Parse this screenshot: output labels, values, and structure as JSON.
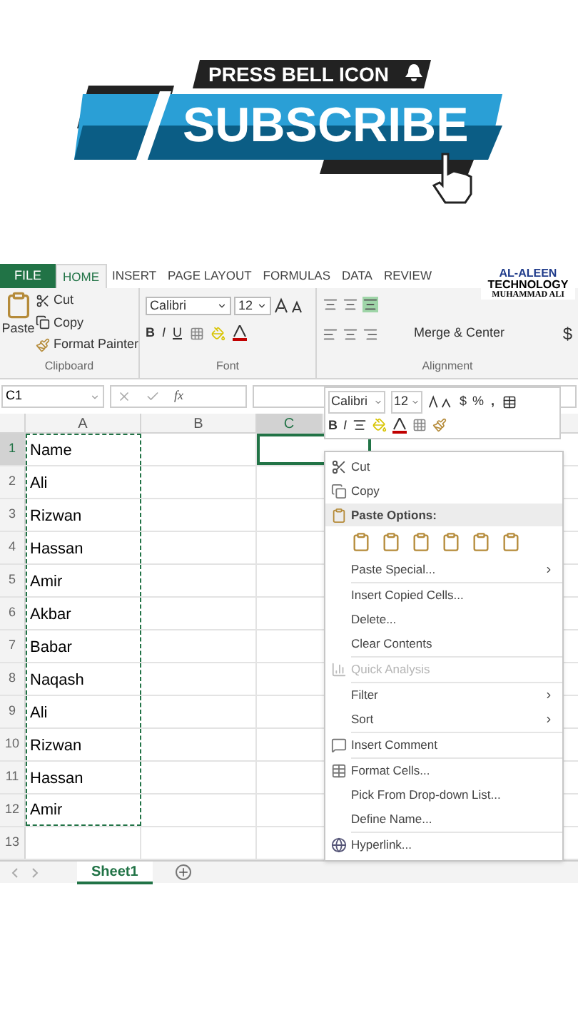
{
  "banner": {
    "top_text": "PRESS BELL ICON",
    "main_text": "SUBSCRIBE"
  },
  "logo": {
    "line1": "AL-ALEEN",
    "line2": "TECHNOLOGY",
    "line3": "MUHAMMAD ALI"
  },
  "tabs": [
    {
      "label": "FILE",
      "kind": "file",
      "selected": false
    },
    {
      "label": "HOME",
      "kind": "tab",
      "selected": true
    },
    {
      "label": "INSERT",
      "kind": "tab",
      "selected": false
    },
    {
      "label": "PAGE LAYOUT",
      "kind": "tab",
      "selected": false
    },
    {
      "label": "FORMULAS",
      "kind": "tab",
      "selected": false
    },
    {
      "label": "DATA",
      "kind": "tab",
      "selected": false
    },
    {
      "label": "REVIEW",
      "kind": "tab",
      "selected": false
    }
  ],
  "clipboard": {
    "paste": "Paste",
    "cut": "Cut",
    "copy": "Copy",
    "format_painter": "Format Painter",
    "group_label": "Clipboard"
  },
  "font": {
    "font_name": "Calibri",
    "font_size": "12",
    "bold": "B",
    "italic": "I",
    "underline": "U",
    "group_label": "Font"
  },
  "alignment": {
    "merge": "Merge & Center",
    "group_label": "Alignment",
    "currency": "$"
  },
  "formula_bar": {
    "name_box": "C1",
    "fx": "fx"
  },
  "columns": [
    {
      "label": "A",
      "selected": false
    },
    {
      "label": "B",
      "selected": false
    },
    {
      "label": "C",
      "selected": true
    }
  ],
  "rows": [
    {
      "number": "1",
      "value": "Name",
      "selected": true
    },
    {
      "number": "2",
      "value": "Ali",
      "selected": false
    },
    {
      "number": "3",
      "value": "Rizwan",
      "selected": false
    },
    {
      "number": "4",
      "value": "Hassan",
      "selected": false
    },
    {
      "number": "5",
      "value": "Amir",
      "selected": false
    },
    {
      "number": "6",
      "value": "Akbar",
      "selected": false
    },
    {
      "number": "7",
      "value": "Babar",
      "selected": false
    },
    {
      "number": "8",
      "value": "Naqash",
      "selected": false
    },
    {
      "number": "9",
      "value": "Ali",
      "selected": false
    },
    {
      "number": "10",
      "value": "Rizwan",
      "selected": false
    },
    {
      "number": "11",
      "value": "Hassan",
      "selected": false
    },
    {
      "number": "12",
      "value": "Amir",
      "selected": false
    },
    {
      "number": "13",
      "value": "",
      "selected": false
    }
  ],
  "mini_toolbar": {
    "font_name": "Calibri",
    "font_size": "12",
    "currency": "$",
    "percent": "%",
    "comma": ",",
    "bold": "B",
    "italic": "I"
  },
  "context_menu": [
    {
      "kind": "cut",
      "label": "Cut",
      "disabled": false,
      "submenu": false
    },
    {
      "kind": "copy",
      "label": "Copy",
      "disabled": false,
      "submenu": false
    },
    {
      "kind": "header",
      "label": "Paste Options:"
    },
    {
      "kind": "paste_icons"
    },
    {
      "kind": "item",
      "label": "Paste Special...",
      "disabled": false,
      "submenu": true
    },
    {
      "kind": "separator"
    },
    {
      "kind": "item",
      "label": "Insert Copied Cells...",
      "disabled": false,
      "submenu": false
    },
    {
      "kind": "item",
      "label": "Delete...",
      "disabled": false,
      "submenu": false
    },
    {
      "kind": "item",
      "label": "Clear Contents",
      "disabled": false,
      "submenu": false
    },
    {
      "kind": "separator"
    },
    {
      "kind": "analysis",
      "label": "Quick Analysis",
      "disabled": true,
      "submenu": false
    },
    {
      "kind": "separator"
    },
    {
      "kind": "item",
      "label": "Filter",
      "disabled": false,
      "submenu": true
    },
    {
      "kind": "item",
      "label": "Sort",
      "disabled": false,
      "submenu": true
    },
    {
      "kind": "separator"
    },
    {
      "kind": "comment",
      "label": "Insert Comment",
      "disabled": false,
      "submenu": false
    },
    {
      "kind": "separator"
    },
    {
      "kind": "format",
      "label": "Format Cells...",
      "disabled": false,
      "submenu": false
    },
    {
      "kind": "item",
      "label": "Pick From Drop-down List...",
      "disabled": false,
      "submenu": false
    },
    {
      "kind": "item",
      "label": "Define Name...",
      "disabled": false,
      "submenu": false
    },
    {
      "kind": "separator"
    },
    {
      "kind": "link",
      "label": "Hyperlink...",
      "disabled": false,
      "submenu": false
    }
  ],
  "sheet_tabs": [
    {
      "label": "Sheet1",
      "selected": true
    }
  ]
}
